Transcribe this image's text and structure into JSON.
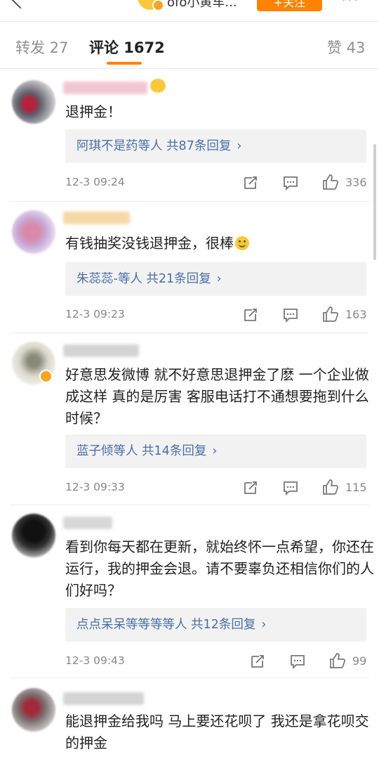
{
  "header": {
    "account_name": "ofo小黄车...",
    "follow_label": "+关注",
    "more_label": "···"
  },
  "tabs": {
    "repost": "转发 27",
    "comments": "评论 1672",
    "likes": "赞 43"
  },
  "comments": [
    {
      "text": "退押金！",
      "replies_label": "阿琪不是药等人  共87条回复",
      "time": "12-3 09:24",
      "likes": "336"
    },
    {
      "text": "有钱抽奖没钱退押金，很棒",
      "replies_label": "朱蕊蕊-等人  共21条回复",
      "time": "12-3 09:23",
      "likes": "163"
    },
    {
      "text": "好意思发微博 就不好意思退押金了麽  一个企业做成这样  真的是厉害  客服电话打不通想要拖到什么时候？",
      "replies_label": "蓝子倾等人  共14条回复",
      "time": "12-3 09:33",
      "likes": "115"
    },
    {
      "text": "看到你每天都在更新，就始终怀一点希望，你还在运行，我的押金会退。请不要辜负还相信你们的人们好吗？",
      "replies_label": "点点呆呆等等等等人  共12条回复",
      "time": "12-3 09:43",
      "likes": "99"
    },
    {
      "text": "能退押金给我吗 马上要还花呗了 我还是拿花呗交的押金"
    }
  ],
  "chevron": "›",
  "colors": {
    "accent": "#ff8200",
    "link": "#4a6fa5",
    "verified": "#f6a623"
  }
}
